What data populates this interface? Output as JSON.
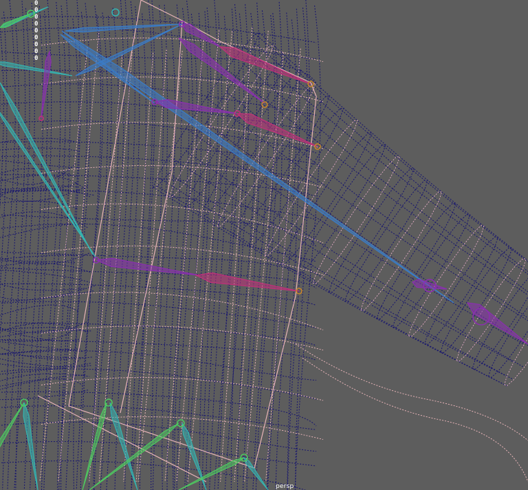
{
  "viewport": {
    "background": "#5d5d5d",
    "camera_label": "persp",
    "hud_values": [
      "0",
      "0",
      "0",
      "0",
      "0",
      "0",
      "0",
      "0",
      "0"
    ]
  },
  "colors": {
    "wire_dark": "#1c1a6e",
    "wire_pink": "#e8b4b8",
    "bone_blue": "#3a7cc8",
    "bone_purple": "#8a2fb0",
    "bone_magenta": "#c0307a",
    "bone_teal": "#35b3b0",
    "bone_green": "#4ec860",
    "joint_orange": "#c8842a"
  }
}
